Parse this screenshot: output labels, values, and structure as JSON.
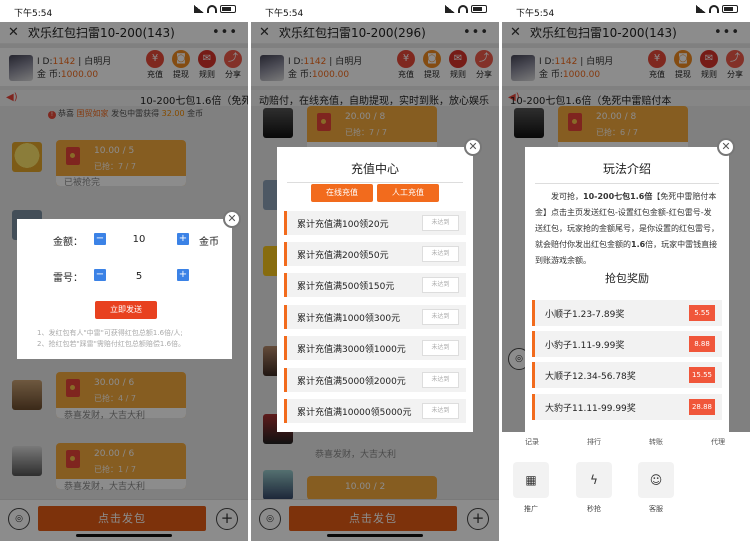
{
  "status": {
    "time": "下午5:54"
  },
  "nav": [
    {
      "title": "欢乐红包扫雷10-200(143)"
    },
    {
      "title": "欢乐红包扫雷10-200(296)"
    },
    {
      "title": "欢乐红包扫雷10-200(143)"
    }
  ],
  "user": {
    "id_label": "I D:",
    "id": "1142",
    "sep": "|",
    "name": "白明月",
    "coin_label": "金 币:",
    "coins": "1000.00"
  },
  "header_buttons": [
    "充值",
    "提现",
    "规则",
    "分享"
  ],
  "notice": {
    "p1": "10-200七包1.6倍（免死中雷赔付",
    "p2": "动赔付，在线充值，自助提现，实时到账，放心娱乐",
    "p3": "10-200七包1.6倍（免死中雷赔付本"
  },
  "win": {
    "prefix": "恭喜",
    "name": "国贸如家",
    "mid": "发包中雷获得",
    "amount": "32.00",
    "suffix": "金币"
  },
  "p1": {
    "rp1": {
      "amt": "10.00 / 5",
      "got": "已抢：7 / 7"
    },
    "msg1": "已被抢完",
    "rp2": {
      "amt": "30.00 / 6",
      "got": "已抢：4 / 7"
    },
    "msg2": "恭喜发财，大吉大利",
    "rp3": {
      "amt": "20.00 / 6",
      "got": "已抢：1 / 7"
    },
    "msg3": "恭喜发财，大吉大利",
    "modal": {
      "amount_label": "金额：",
      "amount": "10",
      "unit": "金币",
      "mine_label": "雷号：",
      "mine": "5",
      "submit": "立即发送",
      "tip1": "1、发红包有人\"中雷\"可获得红包总额1.6倍/人;",
      "tip2": "2、抢红包若\"踩雷\"需赔付红包总额赔偿1.6倍。"
    }
  },
  "p2": {
    "rp1": {
      "amt": "20.00 / 8",
      "got": "已抢：7 / 7"
    },
    "rp_bottom": {
      "amt": "10.00 / 2"
    },
    "modal": {
      "title": "充值中心",
      "tab_online": "在线充值",
      "tab_manual": "人工充值",
      "rows": [
        {
          "t": "累计充值满100领20元",
          "s": "未达到"
        },
        {
          "t": "累计充值满200领50元",
          "s": "未达到"
        },
        {
          "t": "累计充值满500领150元",
          "s": "未达到"
        },
        {
          "t": "累计充值满1000领300元",
          "s": "未达到"
        },
        {
          "t": "累计充值满3000领1000元",
          "s": "未达到"
        },
        {
          "t": "累计充值满5000领2000元",
          "s": "未达到"
        },
        {
          "t": "累计充值满10000领5000元",
          "s": "未达到"
        }
      ]
    },
    "msg": "恭喜发财，大吉大利"
  },
  "p3": {
    "rp1": {
      "amt": "20.00 / 8",
      "got": "已抢：6 / 7"
    },
    "modal": {
      "title": "玩法介绍",
      "intro_a": "发可抢，",
      "intro_b": "10-200七包1.6倍",
      "intro_c": "【免死中雷赔付本金】点击主页发送红包-设置红包金额-红包雷号-发送红包，玩家抢的金额尾号，是你设置的红包雷号，就会赔付你发出红包金额的",
      "intro_d": "1.6",
      "intro_e": "倍，玩家中雷钱直接到账游戏余额。",
      "subtitle": "抢包奖励",
      "rows": [
        {
          "t": "小顺子1.23-7.89奖",
          "v": "5.55"
        },
        {
          "t": "小豹子1.11-9.99奖",
          "v": "8.88"
        },
        {
          "t": "大顺子12.34-56.78奖",
          "v": "15.55"
        },
        {
          "t": "大豹子11.11-99.99奖",
          "v": "28.88"
        }
      ]
    },
    "grid": [
      "记录",
      "排行",
      "转账",
      "代理"
    ],
    "icons": [
      "推广",
      "秒抢",
      "客服"
    ]
  },
  "send_label": "点击发包"
}
